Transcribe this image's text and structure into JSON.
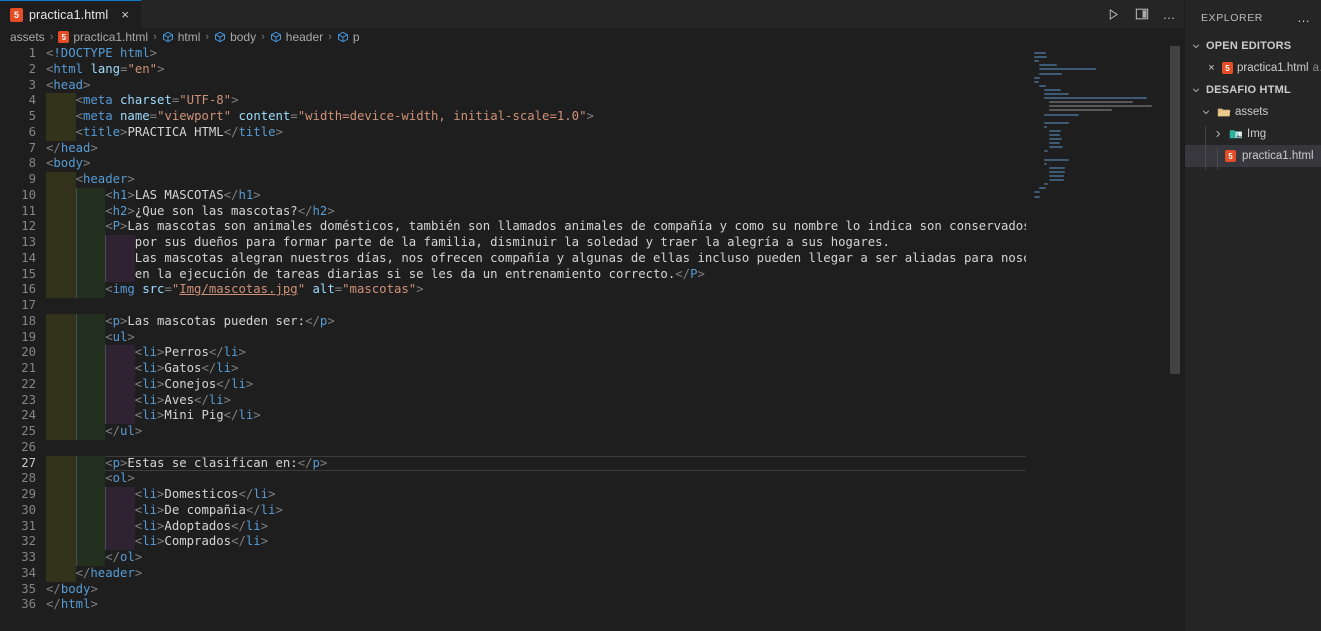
{
  "window": {
    "app": "Visual Studio Code",
    "theme_bg": "#1e1e1e",
    "accent": "#0d7bc4"
  },
  "tabbar": {
    "tabs": [
      {
        "label": "practica1.html",
        "icon": "html5-icon",
        "active": true,
        "close_label": "×"
      }
    ],
    "actions": [
      {
        "name": "run-button",
        "label": "Run"
      },
      {
        "name": "split-editor-button",
        "label": "Split Editor Right"
      },
      {
        "name": "more-actions-button",
        "label": "…"
      }
    ]
  },
  "breadcrumb": {
    "items": [
      {
        "label": "assets",
        "icon": "none"
      },
      {
        "label": "practica1.html",
        "icon": "html5-icon"
      },
      {
        "label": "html",
        "icon": "symbol-cube-icon"
      },
      {
        "label": "body",
        "icon": "symbol-cube-icon"
      },
      {
        "label": "header",
        "icon": "symbol-cube-icon"
      },
      {
        "label": "p",
        "icon": "symbol-cube-icon"
      }
    ],
    "separator": "›"
  },
  "editor": {
    "language": "html",
    "current_line": 27,
    "total_lines": 36,
    "lines": [
      {
        "n": 1,
        "indent": 0,
        "tokens": [
          {
            "t": "punc",
            "v": "<"
          },
          {
            "t": "doctype",
            "v": "!DOCTYPE html"
          },
          {
            "t": "punc",
            "v": ">"
          }
        ]
      },
      {
        "n": 2,
        "indent": 0,
        "tokens": [
          {
            "t": "punc",
            "v": "<"
          },
          {
            "t": "tag",
            "v": "html"
          },
          {
            "t": "txt",
            "v": " "
          },
          {
            "t": "attr",
            "v": "lang"
          },
          {
            "t": "punc",
            "v": "="
          },
          {
            "t": "str",
            "v": "\"en\""
          },
          {
            "t": "punc",
            "v": ">"
          }
        ]
      },
      {
        "n": 3,
        "indent": 0,
        "tokens": [
          {
            "t": "punc",
            "v": "<"
          },
          {
            "t": "tag",
            "v": "head"
          },
          {
            "t": "punc",
            "v": ">"
          }
        ]
      },
      {
        "n": 4,
        "indent": 1,
        "tokens": [
          {
            "t": "punc",
            "v": "<"
          },
          {
            "t": "tag",
            "v": "meta"
          },
          {
            "t": "txt",
            "v": " "
          },
          {
            "t": "attr",
            "v": "charset"
          },
          {
            "t": "punc",
            "v": "="
          },
          {
            "t": "str",
            "v": "\"UTF-8\""
          },
          {
            "t": "punc",
            "v": ">"
          }
        ]
      },
      {
        "n": 5,
        "indent": 1,
        "tokens": [
          {
            "t": "punc",
            "v": "<"
          },
          {
            "t": "tag",
            "v": "meta"
          },
          {
            "t": "txt",
            "v": " "
          },
          {
            "t": "attr",
            "v": "name"
          },
          {
            "t": "punc",
            "v": "="
          },
          {
            "t": "str",
            "v": "\"viewport\""
          },
          {
            "t": "txt",
            "v": " "
          },
          {
            "t": "attr",
            "v": "content"
          },
          {
            "t": "punc",
            "v": "="
          },
          {
            "t": "str",
            "v": "\"width=device-width, initial-scale=1.0\""
          },
          {
            "t": "punc",
            "v": ">"
          }
        ]
      },
      {
        "n": 6,
        "indent": 1,
        "tokens": [
          {
            "t": "punc",
            "v": "<"
          },
          {
            "t": "tag",
            "v": "title"
          },
          {
            "t": "punc",
            "v": ">"
          },
          {
            "t": "txt",
            "v": "PRACTICA HTML"
          },
          {
            "t": "punc",
            "v": "</"
          },
          {
            "t": "tag",
            "v": "title"
          },
          {
            "t": "punc",
            "v": ">"
          }
        ]
      },
      {
        "n": 7,
        "indent": 0,
        "tokens": [
          {
            "t": "punc",
            "v": "</"
          },
          {
            "t": "tag",
            "v": "head"
          },
          {
            "t": "punc",
            "v": ">"
          }
        ]
      },
      {
        "n": 8,
        "indent": 0,
        "tokens": [
          {
            "t": "punc",
            "v": "<"
          },
          {
            "t": "tag",
            "v": "body"
          },
          {
            "t": "punc",
            "v": ">"
          }
        ]
      },
      {
        "n": 9,
        "indent": 1,
        "tokens": [
          {
            "t": "punc",
            "v": "<"
          },
          {
            "t": "tag",
            "v": "header"
          },
          {
            "t": "punc",
            "v": ">"
          }
        ]
      },
      {
        "n": 10,
        "indent": 2,
        "tokens": [
          {
            "t": "punc",
            "v": "<"
          },
          {
            "t": "tag",
            "v": "h1"
          },
          {
            "t": "punc",
            "v": ">"
          },
          {
            "t": "txt",
            "v": "LAS MASCOTAS"
          },
          {
            "t": "punc",
            "v": "</"
          },
          {
            "t": "tag",
            "v": "h1"
          },
          {
            "t": "punc",
            "v": ">"
          }
        ]
      },
      {
        "n": 11,
        "indent": 2,
        "tokens": [
          {
            "t": "punc",
            "v": "<"
          },
          {
            "t": "tag",
            "v": "h2"
          },
          {
            "t": "punc",
            "v": ">"
          },
          {
            "t": "txt",
            "v": "¿Que son las mascotas?"
          },
          {
            "t": "punc",
            "v": "</"
          },
          {
            "t": "tag",
            "v": "h2"
          },
          {
            "t": "punc",
            "v": ">"
          }
        ]
      },
      {
        "n": 12,
        "indent": 2,
        "tokens": [
          {
            "t": "punc",
            "v": "<"
          },
          {
            "t": "tag",
            "v": "P"
          },
          {
            "t": "punc",
            "v": ">"
          },
          {
            "t": "txt",
            "v": "Las mascotas son animales domésticos, también son llamados animales de compañía y como su nombre lo indica son conservados"
          }
        ]
      },
      {
        "n": 13,
        "indent": 3,
        "tokens": [
          {
            "t": "txt",
            "v": "por sus dueños para formar parte de la familia, disminuir la soledad y traer la alegría a sus hogares."
          }
        ]
      },
      {
        "n": 14,
        "indent": 3,
        "tokens": [
          {
            "t": "txt",
            "v": "Las mascotas alegran nuestros días, nos ofrecen compañía y algunas de ellas incluso pueden llegar a ser aliadas para nosotros"
          }
        ]
      },
      {
        "n": 15,
        "indent": 3,
        "tokens": [
          {
            "t": "txt",
            "v": "en la ejecución de tareas diarias si se les da un entrenamiento correcto."
          },
          {
            "t": "punc",
            "v": "</"
          },
          {
            "t": "tag",
            "v": "P"
          },
          {
            "t": "punc",
            "v": ">"
          }
        ]
      },
      {
        "n": 16,
        "indent": 2,
        "tokens": [
          {
            "t": "punc",
            "v": "<"
          },
          {
            "t": "tag",
            "v": "img"
          },
          {
            "t": "txt",
            "v": " "
          },
          {
            "t": "attr",
            "v": "src"
          },
          {
            "t": "punc",
            "v": "="
          },
          {
            "t": "str",
            "v": "\""
          },
          {
            "t": "link",
            "v": "Img/mascotas.jpg"
          },
          {
            "t": "str",
            "v": "\""
          },
          {
            "t": "txt",
            "v": " "
          },
          {
            "t": "attr",
            "v": "alt"
          },
          {
            "t": "punc",
            "v": "="
          },
          {
            "t": "str",
            "v": "\"mascotas\""
          },
          {
            "t": "punc",
            "v": ">"
          }
        ]
      },
      {
        "n": 17,
        "indent": 0,
        "tokens": []
      },
      {
        "n": 18,
        "indent": 2,
        "tokens": [
          {
            "t": "punc",
            "v": "<"
          },
          {
            "t": "tag",
            "v": "p"
          },
          {
            "t": "punc",
            "v": ">"
          },
          {
            "t": "txt",
            "v": "Las mascotas pueden ser:"
          },
          {
            "t": "punc",
            "v": "</"
          },
          {
            "t": "tag",
            "v": "p"
          },
          {
            "t": "punc",
            "v": ">"
          }
        ]
      },
      {
        "n": 19,
        "indent": 2,
        "tokens": [
          {
            "t": "punc",
            "v": "<"
          },
          {
            "t": "tag",
            "v": "ul"
          },
          {
            "t": "punc",
            "v": ">"
          }
        ]
      },
      {
        "n": 20,
        "indent": 3,
        "tokens": [
          {
            "t": "punc",
            "v": "<"
          },
          {
            "t": "tag",
            "v": "li"
          },
          {
            "t": "punc",
            "v": ">"
          },
          {
            "t": "txt",
            "v": "Perros"
          },
          {
            "t": "punc",
            "v": "</"
          },
          {
            "t": "tag",
            "v": "li"
          },
          {
            "t": "punc",
            "v": ">"
          }
        ]
      },
      {
        "n": 21,
        "indent": 3,
        "tokens": [
          {
            "t": "punc",
            "v": "<"
          },
          {
            "t": "tag",
            "v": "li"
          },
          {
            "t": "punc",
            "v": ">"
          },
          {
            "t": "txt",
            "v": "Gatos"
          },
          {
            "t": "punc",
            "v": "</"
          },
          {
            "t": "tag",
            "v": "li"
          },
          {
            "t": "punc",
            "v": ">"
          }
        ]
      },
      {
        "n": 22,
        "indent": 3,
        "tokens": [
          {
            "t": "punc",
            "v": "<"
          },
          {
            "t": "tag",
            "v": "li"
          },
          {
            "t": "punc",
            "v": ">"
          },
          {
            "t": "txt",
            "v": "Conejos"
          },
          {
            "t": "punc",
            "v": "</"
          },
          {
            "t": "tag",
            "v": "li"
          },
          {
            "t": "punc",
            "v": ">"
          }
        ]
      },
      {
        "n": 23,
        "indent": 3,
        "tokens": [
          {
            "t": "punc",
            "v": "<"
          },
          {
            "t": "tag",
            "v": "li"
          },
          {
            "t": "punc",
            "v": ">"
          },
          {
            "t": "txt",
            "v": "Aves"
          },
          {
            "t": "punc",
            "v": "</"
          },
          {
            "t": "tag",
            "v": "li"
          },
          {
            "t": "punc",
            "v": ">"
          }
        ]
      },
      {
        "n": 24,
        "indent": 3,
        "tokens": [
          {
            "t": "punc",
            "v": "<"
          },
          {
            "t": "tag",
            "v": "li"
          },
          {
            "t": "punc",
            "v": ">"
          },
          {
            "t": "txt",
            "v": "Mini Pig"
          },
          {
            "t": "punc",
            "v": "</"
          },
          {
            "t": "tag",
            "v": "li"
          },
          {
            "t": "punc",
            "v": ">"
          }
        ]
      },
      {
        "n": 25,
        "indent": 2,
        "tokens": [
          {
            "t": "punc",
            "v": "</"
          },
          {
            "t": "tag",
            "v": "ul"
          },
          {
            "t": "punc",
            "v": ">"
          }
        ]
      },
      {
        "n": 26,
        "indent": 0,
        "tokens": []
      },
      {
        "n": 27,
        "indent": 2,
        "tokens": [
          {
            "t": "punc",
            "v": "<"
          },
          {
            "t": "tag",
            "v": "p"
          },
          {
            "t": "punc",
            "v": ">"
          },
          {
            "t": "txt",
            "v": "Estas se clasifican en:"
          },
          {
            "t": "punc",
            "v": "</"
          },
          {
            "t": "tag",
            "v": "p"
          },
          {
            "t": "punc",
            "v": ">"
          }
        ]
      },
      {
        "n": 28,
        "indent": 2,
        "tokens": [
          {
            "t": "punc",
            "v": "<"
          },
          {
            "t": "tag",
            "v": "ol"
          },
          {
            "t": "punc",
            "v": ">"
          }
        ]
      },
      {
        "n": 29,
        "indent": 3,
        "tokens": [
          {
            "t": "punc",
            "v": "<"
          },
          {
            "t": "tag",
            "v": "li"
          },
          {
            "t": "punc",
            "v": ">"
          },
          {
            "t": "txt",
            "v": "Domesticos"
          },
          {
            "t": "punc",
            "v": "</"
          },
          {
            "t": "tag",
            "v": "li"
          },
          {
            "t": "punc",
            "v": ">"
          }
        ]
      },
      {
        "n": 30,
        "indent": 3,
        "tokens": [
          {
            "t": "punc",
            "v": "<"
          },
          {
            "t": "tag",
            "v": "li"
          },
          {
            "t": "punc",
            "v": ">"
          },
          {
            "t": "txt",
            "v": "De compañia"
          },
          {
            "t": "punc",
            "v": "</"
          },
          {
            "t": "tag",
            "v": "li"
          },
          {
            "t": "punc",
            "v": ">"
          }
        ]
      },
      {
        "n": 31,
        "indent": 3,
        "tokens": [
          {
            "t": "punc",
            "v": "<"
          },
          {
            "t": "tag",
            "v": "li"
          },
          {
            "t": "punc",
            "v": ">"
          },
          {
            "t": "txt",
            "v": "Adoptados"
          },
          {
            "t": "punc",
            "v": "</"
          },
          {
            "t": "tag",
            "v": "li"
          },
          {
            "t": "punc",
            "v": ">"
          }
        ]
      },
      {
        "n": 32,
        "indent": 3,
        "tokens": [
          {
            "t": "punc",
            "v": "<"
          },
          {
            "t": "tag",
            "v": "li"
          },
          {
            "t": "punc",
            "v": ">"
          },
          {
            "t": "txt",
            "v": "Comprados"
          },
          {
            "t": "punc",
            "v": "</"
          },
          {
            "t": "tag",
            "v": "li"
          },
          {
            "t": "punc",
            "v": ">"
          }
        ]
      },
      {
        "n": 33,
        "indent": 2,
        "tokens": [
          {
            "t": "punc",
            "v": "</"
          },
          {
            "t": "tag",
            "v": "ol"
          },
          {
            "t": "punc",
            "v": ">"
          }
        ]
      },
      {
        "n": 34,
        "indent": 1,
        "tokens": [
          {
            "t": "punc",
            "v": "</"
          },
          {
            "t": "tag",
            "v": "header"
          },
          {
            "t": "punc",
            "v": ">"
          }
        ]
      },
      {
        "n": 35,
        "indent": 0,
        "tokens": [
          {
            "t": "punc",
            "v": "</"
          },
          {
            "t": "tag",
            "v": "body"
          },
          {
            "t": "punc",
            "v": ">"
          }
        ]
      },
      {
        "n": 36,
        "indent": 0,
        "tokens": [
          {
            "t": "punc",
            "v": "</"
          },
          {
            "t": "tag",
            "v": "html"
          },
          {
            "t": "punc",
            "v": ">"
          }
        ]
      }
    ]
  },
  "sidebar": {
    "title": "EXPLORER",
    "more_label": "…",
    "sections": [
      {
        "name": "open-editors",
        "label": "OPEN EDITORS",
        "expanded": true,
        "rows": [
          {
            "name": "open-editor-practica1",
            "label": "practica1.html",
            "suffix": "a…",
            "icon": "html5-icon",
            "close": "×",
            "selected": false
          }
        ]
      },
      {
        "name": "workspace-folder",
        "label": "DESAFIO HTML",
        "expanded": true,
        "rows": [
          {
            "name": "folder-assets",
            "label": "assets",
            "icon": "folder-open-icon",
            "chevron": "⌄",
            "depth": 1,
            "selected": false
          },
          {
            "name": "folder-img",
            "label": "Img",
            "icon": "folder-image-icon",
            "chevron": "›",
            "depth": 2,
            "selected": false
          },
          {
            "name": "file-practica1",
            "label": "practica1.html",
            "icon": "html5-icon",
            "chevron": "",
            "depth": 3,
            "selected": true
          }
        ]
      }
    ]
  }
}
